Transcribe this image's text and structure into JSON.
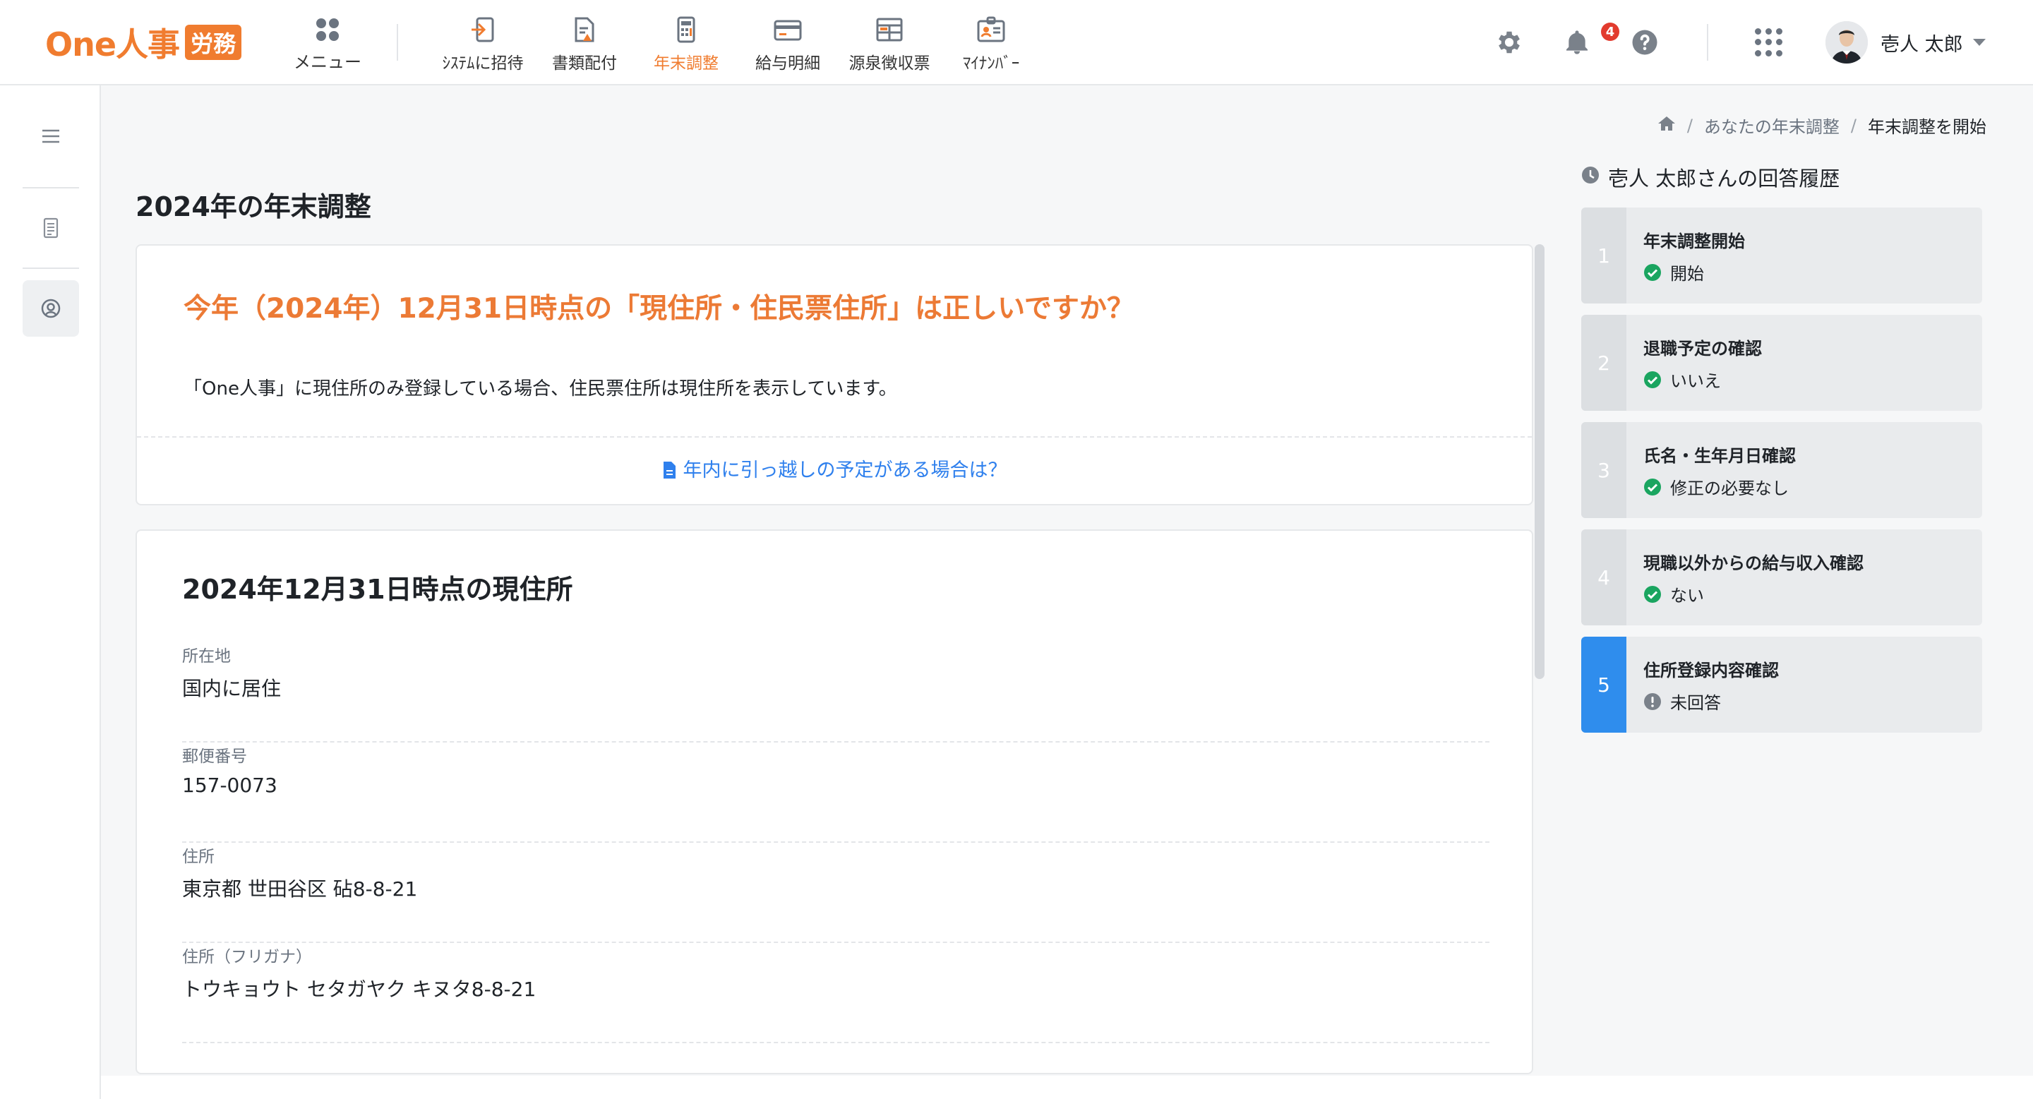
{
  "header": {
    "logo_text": "One人事",
    "logo_badge": "労務",
    "menu_label": "メニュー",
    "nav": [
      {
        "label": "ｼｽﾃﾑに招待",
        "icon": "invite-icon"
      },
      {
        "label": "書類配付",
        "icon": "document-distribution-icon"
      },
      {
        "label": "年末調整",
        "icon": "calculator-icon",
        "active": true
      },
      {
        "label": "給与明細",
        "icon": "payslip-icon"
      },
      {
        "label": "源泉徴収票",
        "icon": "withholding-slip-icon"
      },
      {
        "label": "ﾏｲﾅﾝﾊﾞｰ",
        "icon": "id-card-icon"
      }
    ],
    "notification_count": "4",
    "user_name": "壱人 太郎"
  },
  "breadcrumb": {
    "parent": "あなたの年末調整",
    "current": "年末調整を開始"
  },
  "page_title": "2024年の年末調整",
  "question": {
    "title": "今年（2024年）12月31日時点の「現住所・住民票住所」は正しいですか？",
    "description": "「One人事」に現住所のみ登録している場合、住民票住所は現住所を表示しています。",
    "help_link": "年内に引っ越しの予定がある場合は？"
  },
  "address": {
    "title": "2024年12月31日時点の現住所",
    "fields": [
      {
        "label": "所在地",
        "value": "国内に居住"
      },
      {
        "label": "郵便番号",
        "value": "157-0073"
      },
      {
        "label": "住所",
        "value": "東京都 世田谷区 砧8-8-21"
      },
      {
        "label": "住所（フリガナ）",
        "value": "トウキョウト セタガヤク キヌタ8-8-21"
      }
    ]
  },
  "history": {
    "title": "壱人 太郎さんの回答履歴",
    "items": [
      {
        "num": "1",
        "label": "年末調整開始",
        "answer": "開始",
        "status": "done"
      },
      {
        "num": "2",
        "label": "退職予定の確認",
        "answer": "いいえ",
        "status": "done"
      },
      {
        "num": "3",
        "label": "氏名・生年月日確認",
        "answer": "修正の必要なし",
        "status": "done"
      },
      {
        "num": "4",
        "label": "現職以外からの給与収入確認",
        "answer": "ない",
        "status": "done"
      },
      {
        "num": "5",
        "label": "住所登録内容確認",
        "answer": "未回答",
        "status": "pending"
      }
    ]
  },
  "colors": {
    "brand": "#f07c2f",
    "link": "#2f80ed",
    "done": "#1aa560",
    "current_step": "#2f8ded"
  }
}
